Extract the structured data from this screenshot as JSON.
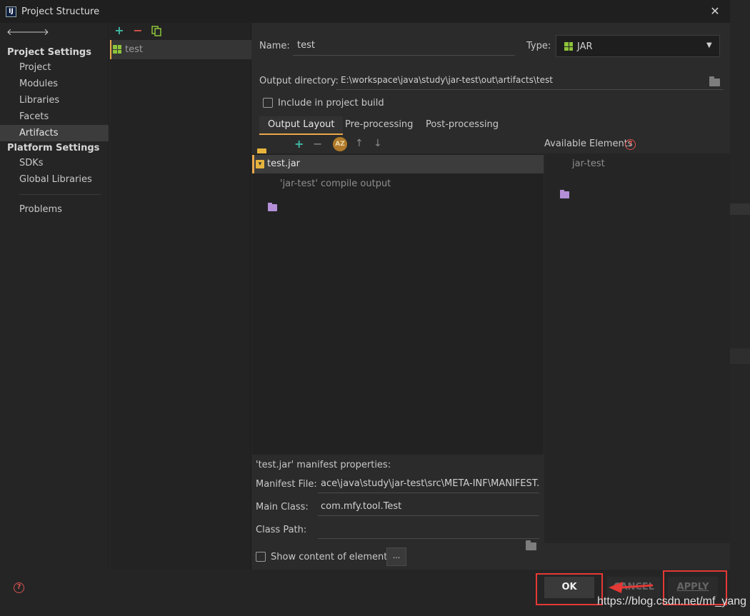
{
  "window": {
    "title": "Project Structure",
    "close": "✕",
    "app_icon": "IJ"
  },
  "sidebar": {
    "project_settings_title": "Project Settings",
    "project_items": [
      {
        "label": "Project"
      },
      {
        "label": "Modules"
      },
      {
        "label": "Libraries"
      },
      {
        "label": "Facets"
      },
      {
        "label": "Artifacts",
        "selected": true
      }
    ],
    "platform_settings_title": "Platform Settings",
    "platform_items": [
      {
        "label": "SDKs"
      },
      {
        "label": "Global Libraries"
      }
    ],
    "problems_label": "Problems"
  },
  "artifacts_list": {
    "items": [
      {
        "label": "test",
        "icon": "jar-icon"
      }
    ]
  },
  "form": {
    "name_label": "Name:",
    "name_value": "test",
    "type_label": "Type:",
    "type_value": "JAR",
    "output_dir_label": "Output directory:",
    "output_dir_value": "E:\\workspace\\java\\study\\jar-test\\out\\artifacts\\test",
    "include_label": "Include in project build",
    "include_checked": false
  },
  "tabs": [
    {
      "label": "Output Layout",
      "selected": true
    },
    {
      "label": "Pre-processing"
    },
    {
      "label": "Post-processing"
    }
  ],
  "layout_tree": {
    "items": [
      {
        "label": "test.jar"
      },
      {
        "label": "'jar-test' compile output"
      }
    ]
  },
  "available": {
    "title": "Available Elements",
    "items": [
      {
        "label": "jar-test"
      }
    ]
  },
  "manifest": {
    "title": "'test.jar' manifest properties:",
    "file_label": "Manifest File:",
    "file_value": "ace\\java\\study\\jar-test\\src\\META-INF\\MANIFEST.MF",
    "main_class_label": "Main Class:",
    "main_class_value": "com.mfy.tool.Test",
    "class_path_label": "Class Path:",
    "class_path_value": ""
  },
  "show_content_label": "Show content of elements",
  "dots_label": "...",
  "buttons": {
    "ok": "OK",
    "cancel": "CANCEL",
    "apply": "APPLY"
  },
  "watermark": "https://blog.csdn.net/mf_yang",
  "colors": {
    "accent": "#e9a84a",
    "highlight_box": "#e53935",
    "jar_green": "#8dc33a"
  }
}
